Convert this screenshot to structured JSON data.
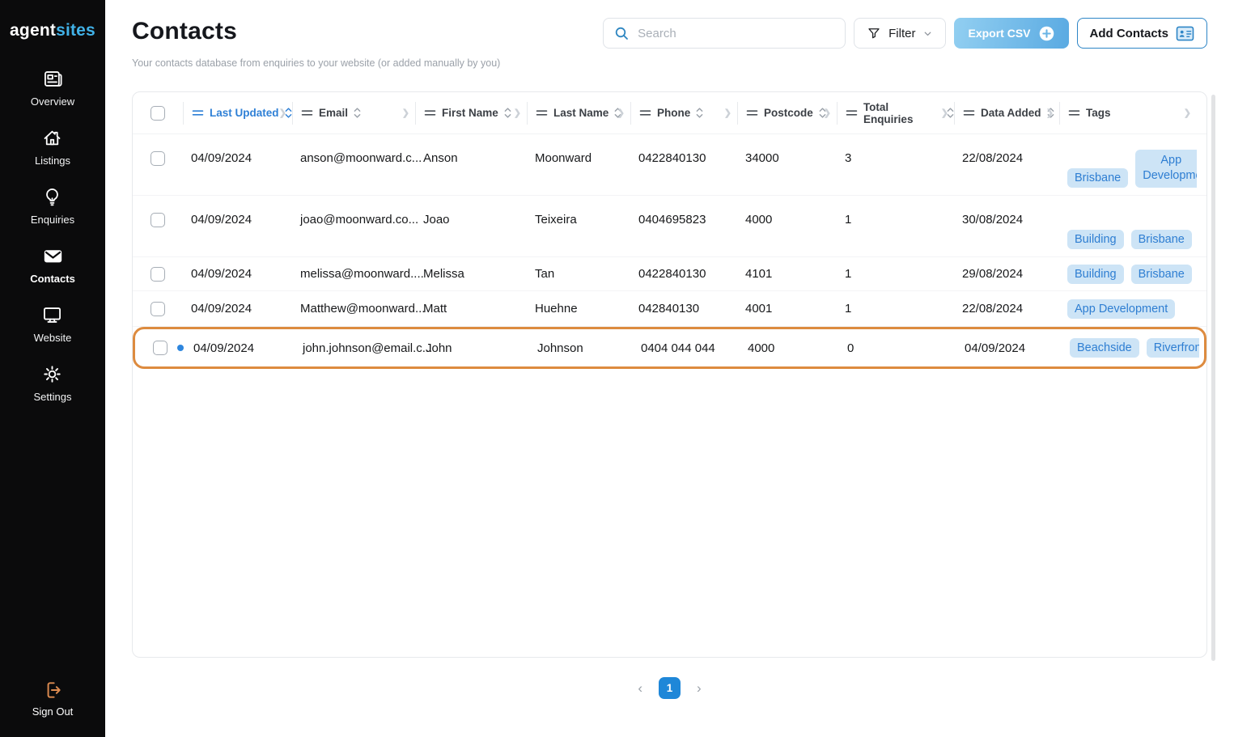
{
  "brand": {
    "name_primary": "agent",
    "name_secondary": "sites"
  },
  "sidebar": {
    "items": [
      {
        "label": "Overview"
      },
      {
        "label": "Listings"
      },
      {
        "label": "Enquiries"
      },
      {
        "label": "Contacts",
        "active": true
      },
      {
        "label": "Website"
      },
      {
        "label": "Settings"
      }
    ],
    "sign_out_label": "Sign Out"
  },
  "header": {
    "title": "Contacts",
    "subtitle": "Your contacts database from enquiries to your website (or added manually by you)",
    "search": {
      "placeholder": "Search"
    },
    "filter_label": "Filter",
    "export_csv_label": "Export CSV",
    "add_contacts_label": "Add Contacts"
  },
  "table": {
    "columns": [
      {
        "label": "Last Updated",
        "sorted": true
      },
      {
        "label": "Email"
      },
      {
        "label": "First Name"
      },
      {
        "label": "Last Name"
      },
      {
        "label": "Phone"
      },
      {
        "label": "Postcode"
      },
      {
        "label": "Total Enquiries"
      },
      {
        "label": "Data Added"
      },
      {
        "label": "Tags"
      }
    ],
    "rows": [
      {
        "last_updated": "04/09/2024",
        "email": "anson@moonward.c...",
        "first_name": "Anson",
        "last_name": "Moonward",
        "phone": "0422840130",
        "postcode": "34000",
        "total_enquiries": "3",
        "date_added": "22/08/2024",
        "tags": [
          "Brisbane",
          "App Development"
        ]
      },
      {
        "last_updated": "04/09/2024",
        "email": "joao@moonward.co...",
        "first_name": "Joao",
        "last_name": "Teixeira",
        "phone": "0404695823",
        "postcode": "4000",
        "total_enquiries": "1",
        "date_added": "30/08/2024",
        "tags": [
          "Building",
          "Brisbane"
        ]
      },
      {
        "last_updated": "04/09/2024",
        "email": "melissa@moonward....",
        "first_name": "Melissa",
        "last_name": "Tan",
        "phone": "0422840130",
        "postcode": "4101",
        "total_enquiries": "1",
        "date_added": "29/08/2024",
        "tags": [
          "Building",
          "Brisbane"
        ]
      },
      {
        "last_updated": "04/09/2024",
        "email": "Matthew@moonward...",
        "first_name": "Matt",
        "last_name": "Huehne",
        "phone": "042840130",
        "postcode": "4001",
        "total_enquiries": "1",
        "date_added": "22/08/2024",
        "tags": [
          "App Development"
        ]
      },
      {
        "last_updated": "04/09/2024",
        "email": "john.johnson@email.c...",
        "first_name": "John",
        "last_name": "Johnson",
        "phone": "0404 044 044",
        "postcode": "4000",
        "total_enquiries": "0",
        "date_added": "04/09/2024",
        "tags": [
          "Beachside",
          "Riverfront"
        ],
        "highlighted": true,
        "unread": true
      }
    ]
  },
  "pagination": {
    "page": "1"
  },
  "colors": {
    "sidebar_bg": "#0b0b0c",
    "brand_accent": "#41b2e8",
    "sorted_column_blue": "#2f80d6",
    "tag_bg": "#cde4f6",
    "tag_text": "#2e7ed2",
    "highlight_border": "#dd8b3f",
    "signout_orange": "#dd8b50",
    "pagination_active": "#1f87d8",
    "unread_dot": "#2e86de"
  }
}
